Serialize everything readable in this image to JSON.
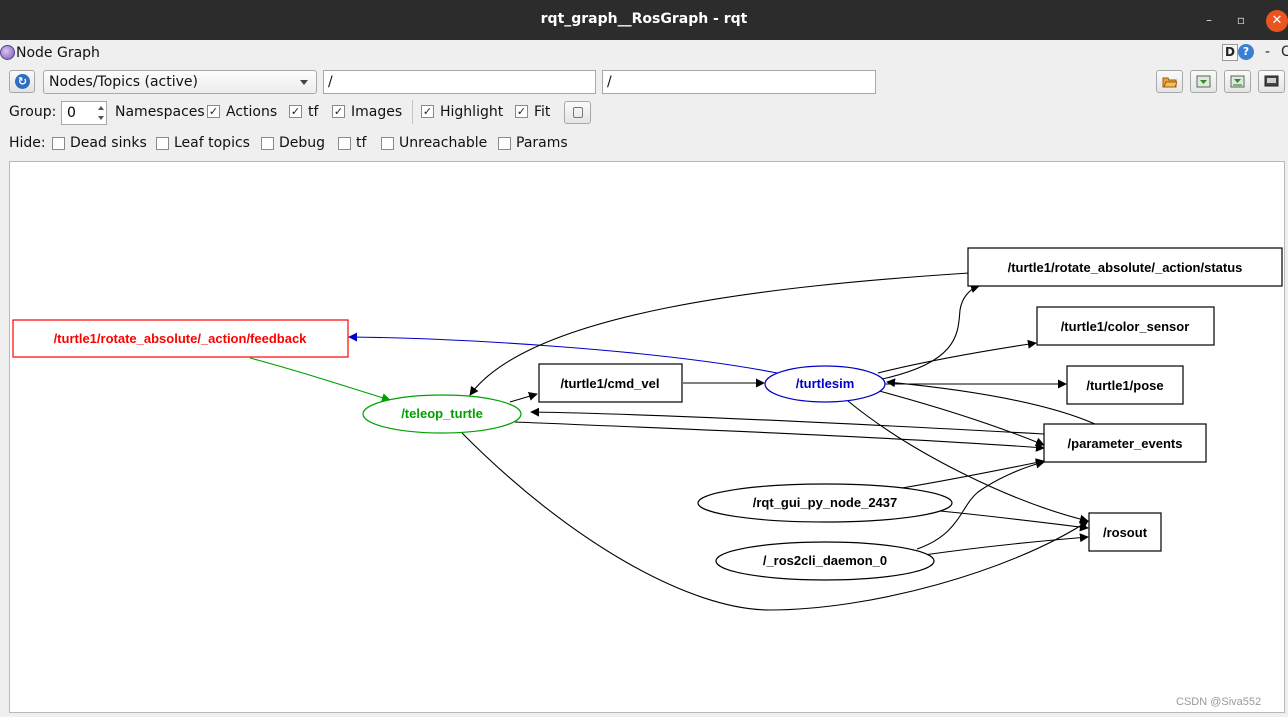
{
  "window": {
    "title": "rqt_graph__RosGraph - rqt",
    "minimize_glyph": "–",
    "maximize_glyph": "▫",
    "close_glyph": "✕"
  },
  "plugin": {
    "title": "Node Graph",
    "d_label": "D",
    "help_label": "?",
    "minimize_label": "-",
    "close_label": "C"
  },
  "toolbar": {
    "graph_mode": "Nodes/Topics (active)",
    "ns_filter": "/",
    "topic_filter": "/"
  },
  "options": {
    "group_label": "Group:",
    "group_value": "0",
    "namespaces_label": "Namespaces",
    "actions": {
      "label": "Actions",
      "checked": true
    },
    "tf": {
      "label": "tf",
      "checked": true
    },
    "images": {
      "label": "Images",
      "checked": true
    },
    "highlight": {
      "label": "Highlight",
      "checked": true
    },
    "fit": {
      "label": "Fit",
      "checked": true
    }
  },
  "hide": {
    "label": "Hide:",
    "dead_sinks": {
      "label": "Dead sinks",
      "checked": false
    },
    "leaf_topics": {
      "label": "Leaf topics",
      "checked": false
    },
    "debug": {
      "label": "Debug",
      "checked": false
    },
    "tf": {
      "label": "tf",
      "checked": false
    },
    "unreachable": {
      "label": "Unreachable",
      "checked": false
    },
    "params": {
      "label": "Params",
      "checked": false
    }
  },
  "graph": {
    "nodes": {
      "feedback": "/turtle1/rotate_absolute/_action/feedback",
      "teleop": "/teleop_turtle",
      "cmd_vel": "/turtle1/cmd_vel",
      "turtlesim": "/turtlesim",
      "status": "/turtle1/rotate_absolute/_action/status",
      "color_sensor": "/turtle1/color_sensor",
      "pose": "/turtle1/pose",
      "param_events": "/parameter_events",
      "rqt_gui": "/rqt_gui_py_node_2437",
      "daemon": "/_ros2cli_daemon_0",
      "rosout": "/rosout"
    },
    "colors": {
      "feedback": "#ff0000",
      "teleop": "#00a000",
      "turtlesim": "#0000c8",
      "default": "#000000"
    }
  },
  "watermark": "CSDN @Siva552"
}
